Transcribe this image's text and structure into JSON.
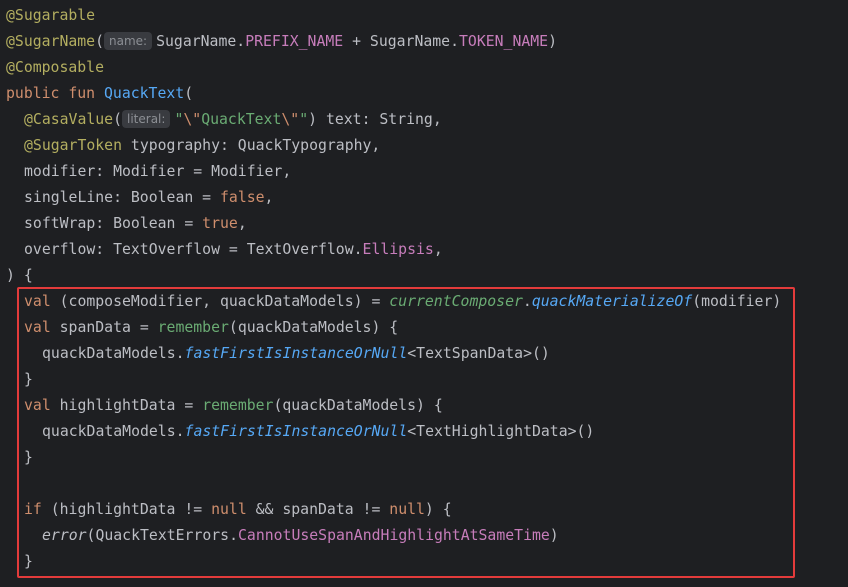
{
  "code": {
    "l1": {
      "ann": "@Sugarable"
    },
    "l2": {
      "ann": "@SugarName",
      "open": "(",
      "hint": "name:",
      "a": "SugarName.",
      "b": "PREFIX_NAME",
      "c": " + SugarName.",
      "d": "TOKEN_NAME",
      "e": ")"
    },
    "l3": {
      "ann": "@Composable"
    },
    "l4": {
      "kw": "public fun ",
      "fn": "QuackText",
      "rest": "("
    },
    "l5": {
      "ann": "@CasaValue",
      "open": "(",
      "hint": "literal:",
      "s1": "\"",
      "esc1": "\\\"",
      "s2": "QuackText",
      "esc2": "\\\"",
      "s3": "\"",
      "rest": ") text: String,"
    },
    "l6": {
      "ann": "@SugarToken",
      "rest": " typography: QuackTypography,"
    },
    "l7": {
      "rest": "modifier: Modifier = Modifier,"
    },
    "l8": {
      "a": "singleLine: Boolean = ",
      "kw": "false",
      "b": ","
    },
    "l9": {
      "a": "softWrap: Boolean = ",
      "kw": "true",
      "b": ","
    },
    "l10": {
      "a": "overflow: TextOverflow = TextOverflow.",
      "c": "Ellipsis",
      "b": ","
    },
    "l11": {
      "rest": ") {"
    },
    "l12": {
      "kw": "val",
      "a": " (composeModifier, quackDataModels) = ",
      "top": "currentComposer",
      "dot": ".",
      "ext": "quackMaterializeOf",
      "b": "(modifier)"
    },
    "l13": {
      "kw": "val",
      "a": " spanData = ",
      "fn": "remember",
      "b": "(quackDataModels) {"
    },
    "l14": {
      "a": "quackDataModels.",
      "ext": "fastFirstIsInstanceOrNull",
      "b": "<TextSpanData>()"
    },
    "l15": {
      "rest": "}"
    },
    "l16": {
      "kw": "val",
      "a": " highlightData = ",
      "fn": "remember",
      "b": "(quackDataModels) {"
    },
    "l17": {
      "a": "quackDataModels.",
      "ext": "fastFirstIsInstanceOrNull",
      "b": "<TextHighlightData>()"
    },
    "l18": {
      "rest": "}"
    },
    "l19": {
      "rest": ""
    },
    "l20": {
      "kw": "if",
      "a": " (highlightData != ",
      "kw2": "null",
      "b": " && spanData != ",
      "kw3": "null",
      "c": ") {"
    },
    "l21": {
      "call": "error",
      "a": "(QuackTextErrors.",
      "const": "CannotUseSpanAndHighlightAtSameTime",
      "b": ")"
    },
    "l22": {
      "rest": "}"
    }
  },
  "colors": {
    "background": "#1e1f22",
    "highlight_box": "#e33b3b",
    "annotation": "#b3ae60",
    "keyword": "#cf8e6d",
    "function": "#56a8f5",
    "string": "#6aab73",
    "constant": "#c77dbb"
  }
}
